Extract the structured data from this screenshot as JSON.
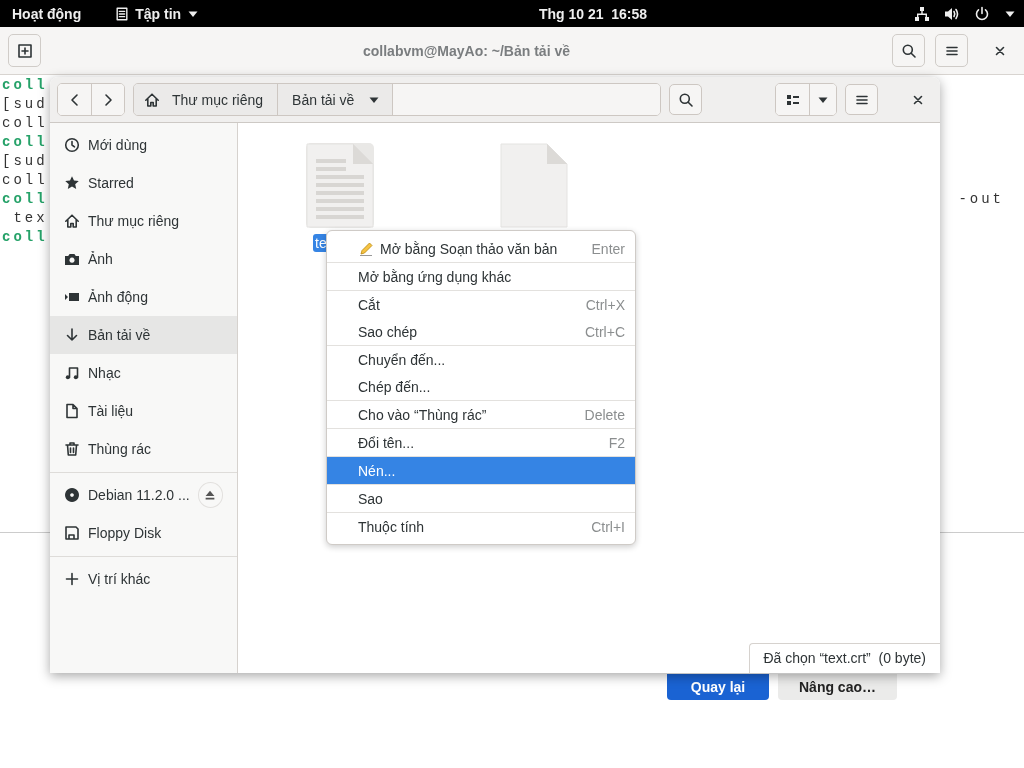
{
  "top_bar": {
    "activities": "Hoạt động",
    "app_menu": "Tập tin",
    "clock": "Thg 10 21  16:58"
  },
  "terminal": {
    "title": "collabvm@MayAo: ~/Bản tải về",
    "lines": [
      {
        "kind": "prompt",
        "text": "coll"
      },
      {
        "kind": "output",
        "text": "[sud"
      },
      {
        "kind": "output",
        "text": "coll"
      },
      {
        "kind": "prompt",
        "text": "coll"
      },
      {
        "kind": "output",
        "text": "[sud"
      },
      {
        "kind": "output",
        "text": "coll"
      },
      {
        "kind": "prompt",
        "text": "coll",
        "right_text": "-out"
      },
      {
        "kind": "output",
        "text": " tex"
      },
      {
        "kind": "prompt",
        "text": "coll"
      }
    ]
  },
  "background_dialog": {
    "buttons": [
      {
        "label": "Quay lại",
        "kind": "primary"
      },
      {
        "label": "Nâng cao…",
        "kind": "secondary"
      }
    ]
  },
  "file_chooser": {
    "path": [
      {
        "label": "Thư mục riêng",
        "kind": "home"
      },
      {
        "label": "Bản tải về",
        "kind": "current"
      }
    ],
    "sidebar": {
      "sections": [
        [
          {
            "label": "Mới dùng",
            "selected": false
          },
          {
            "label": "Starred",
            "selected": false
          },
          {
            "label": "Thư mục riêng",
            "selected": false
          },
          {
            "label": "Ảnh",
            "selected": false
          },
          {
            "label": "Ảnh động",
            "selected": false
          },
          {
            "label": "Bản tải về",
            "selected": true
          },
          {
            "label": "Nhạc",
            "selected": false
          },
          {
            "label": "Tài liệu",
            "selected": false
          },
          {
            "label": "Thùng rác",
            "selected": false
          }
        ],
        [
          {
            "label": "Debian 11.2.0 ...",
            "selected": false,
            "ejectable": true
          },
          {
            "label": "Floppy Disk",
            "selected": false,
            "ejectable": false
          }
        ],
        [
          {
            "label": "Vị trí khác",
            "selected": false
          }
        ]
      ]
    },
    "files": [
      {
        "kind": "text",
        "label": "te",
        "selected": true
      },
      {
        "kind": "blank",
        "selected": false
      }
    ],
    "status": "Đã chọn “text.crt”  (0 byte)"
  },
  "context_menu": {
    "sections": [
      [
        {
          "label": "Mở bằng Soạn thảo văn bản",
          "shortcut": "Enter",
          "kind": "with-icon",
          "selected": false
        }
      ],
      [
        {
          "label": "Mở bằng ứng dụng khác",
          "kind": "plain",
          "selected": false
        }
      ],
      [
        {
          "label": "Cắt",
          "shortcut": "Ctrl+X",
          "kind": "plain",
          "selected": false
        },
        {
          "label": "Sao chép",
          "shortcut": "Ctrl+C",
          "kind": "plain",
          "selected": false
        }
      ],
      [
        {
          "label": "Chuyển đến...",
          "kind": "plain",
          "selected": false
        },
        {
          "label": "Chép đến...",
          "kind": "plain",
          "selected": false
        }
      ],
      [
        {
          "label": "Cho vào “Thùng rác”",
          "shortcut": "Delete",
          "kind": "plain",
          "selected": false
        }
      ],
      [
        {
          "label": "Đổi tên...",
          "shortcut": "F2",
          "kind": "plain",
          "selected": false
        }
      ],
      [
        {
          "label": "Nén...",
          "kind": "plain",
          "selected": true
        }
      ],
      [
        {
          "label": "Sao",
          "kind": "plain",
          "selected": false
        }
      ],
      [
        {
          "label": "Thuộc tính",
          "shortcut": "Ctrl+I",
          "kind": "plain",
          "selected": false
        }
      ]
    ]
  }
}
